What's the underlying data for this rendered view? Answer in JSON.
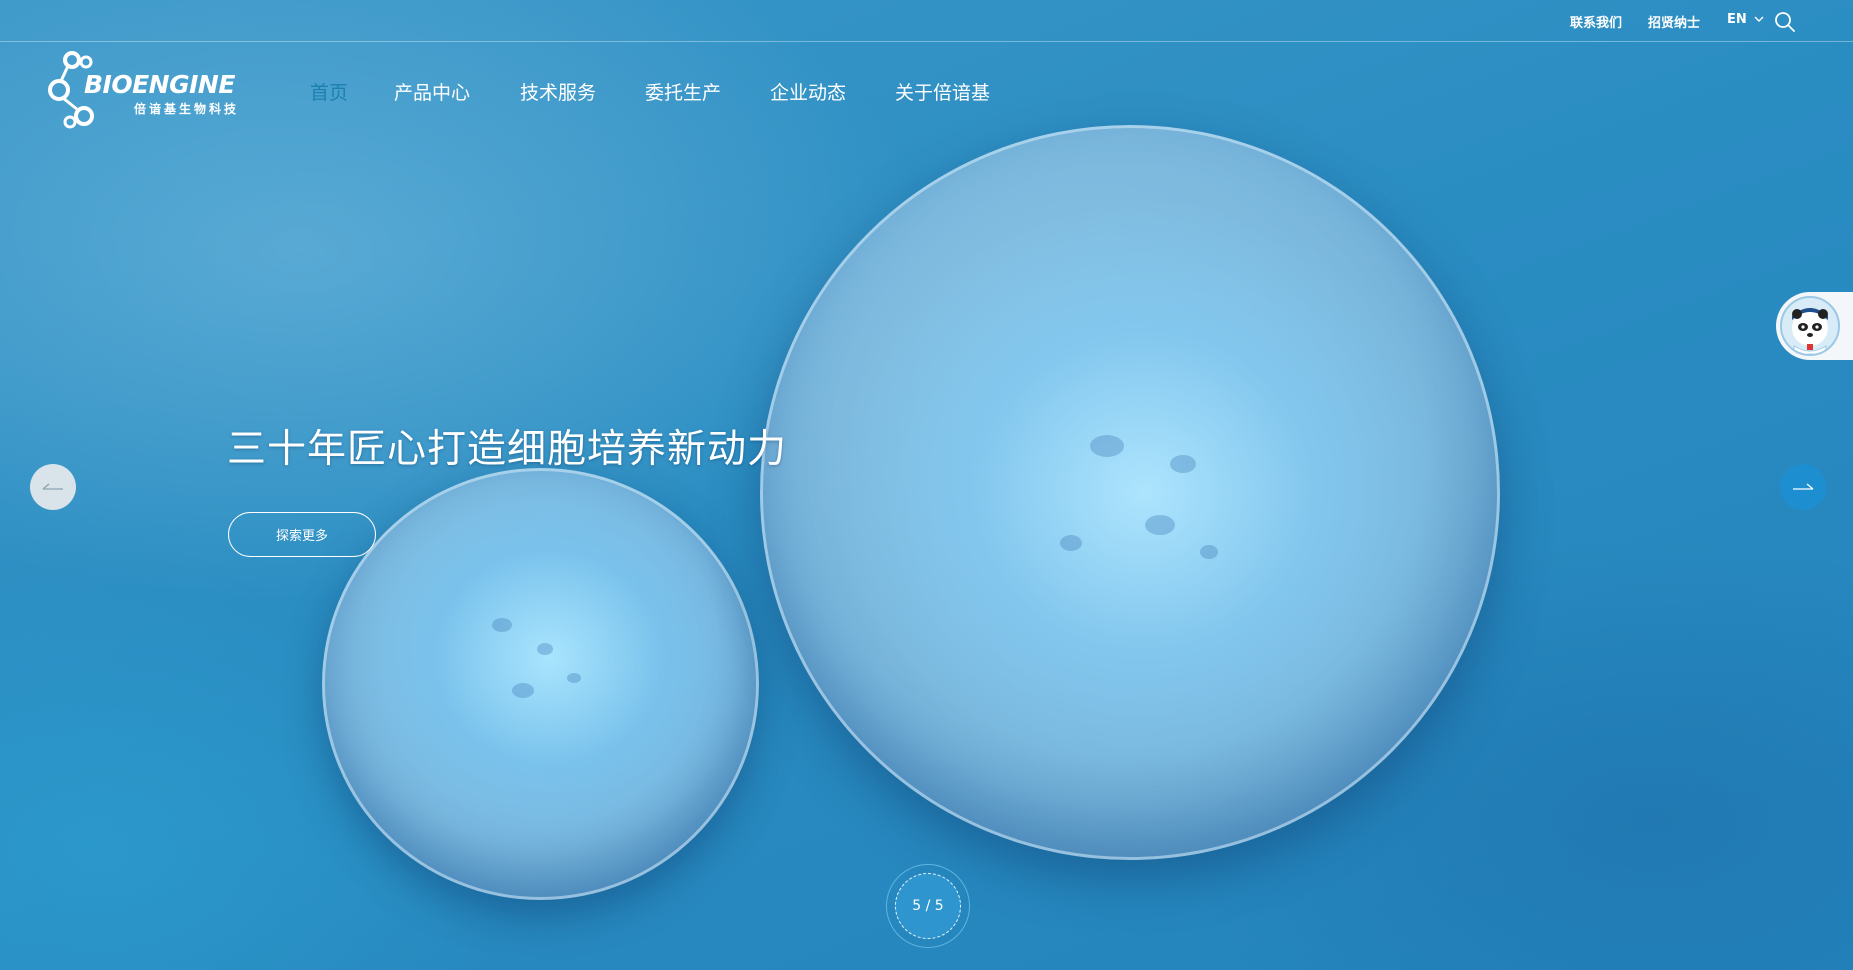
{
  "topbar": {
    "contact": "联系我们",
    "careers": "招贤纳士",
    "language": "EN"
  },
  "logo": {
    "wordmark": "BIOENGINE",
    "subtitle": "倍谙基生物科技"
  },
  "nav": {
    "items": [
      {
        "label": "首页",
        "active": true
      },
      {
        "label": "产品中心"
      },
      {
        "label": "技术服务"
      },
      {
        "label": "委托生产"
      },
      {
        "label": "企业动态"
      },
      {
        "label": "关于倍谙基"
      }
    ]
  },
  "slide": {
    "headline": "三十年匠心打造细胞培养新动力",
    "cta_label": "探索更多",
    "pager": "5 / 5"
  },
  "colors": {
    "background": "#2a8ec0",
    "nav_active": "#1d7fb0",
    "arrow_right": "#1d8fd0"
  }
}
